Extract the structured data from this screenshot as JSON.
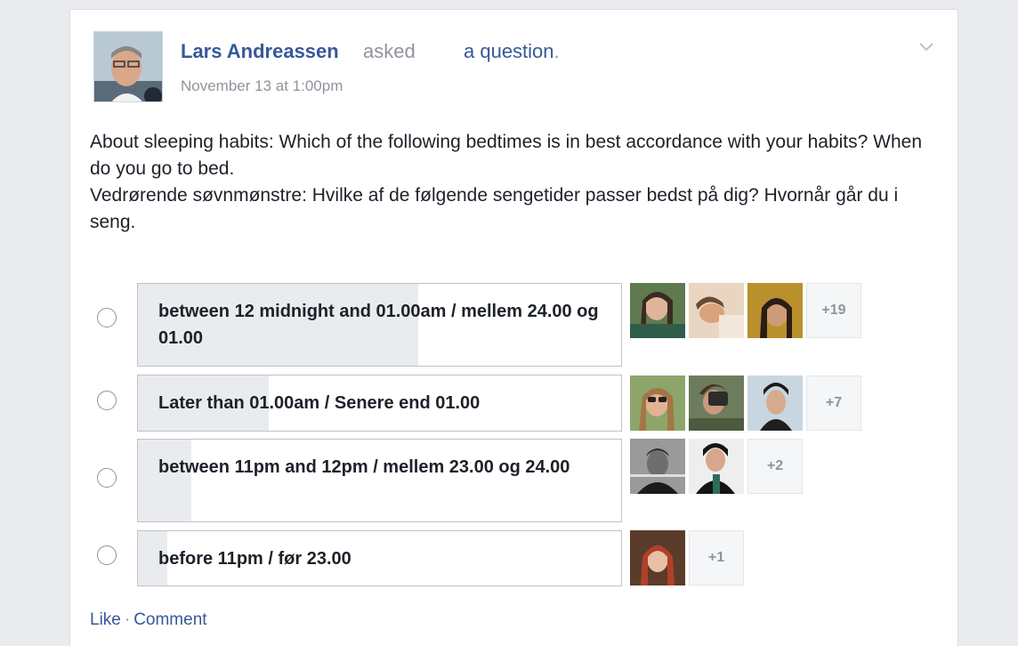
{
  "post": {
    "author": "Lars Andreassen",
    "action_text": "asked",
    "action_link": "a question",
    "period": ".",
    "timestamp": "November 13 at 1:00pm",
    "question_lines": [
      "About sleeping habits: Which of the following bedtimes is in best accordance with your habits? When do you go to bed.",
      "Vedrørende søvnmønstre: Hvilke af de følgende sengetider passer bedst på dig? Hvornår går du i seng."
    ]
  },
  "poll": {
    "options": [
      {
        "label": "between 12 midnight and 01.00am / mellem 24.00 og 01.00",
        "extra_votes": "+19",
        "fill_fraction": 0.58
      },
      {
        "label": "Later than 01.00am / Senere end 01.00",
        "extra_votes": "+7",
        "fill_fraction": 0.27
      },
      {
        "label": "between 11pm and 12pm / mellem 23.00 og 24.00",
        "extra_votes": "+2",
        "fill_fraction": 0.11
      },
      {
        "label": "before 11pm / før 23.00",
        "extra_votes": "+1",
        "fill_fraction": 0.06
      }
    ]
  },
  "footer": {
    "like": "Like",
    "separator": "·",
    "comment": "Comment"
  },
  "colors": {
    "link": "#365899",
    "muted": "#90949c",
    "text": "#1d2129",
    "page_bg": "#e9ebee",
    "bar_fill": "#e9ebee"
  },
  "icons": {
    "post_menu": "chevron-down-icon"
  }
}
